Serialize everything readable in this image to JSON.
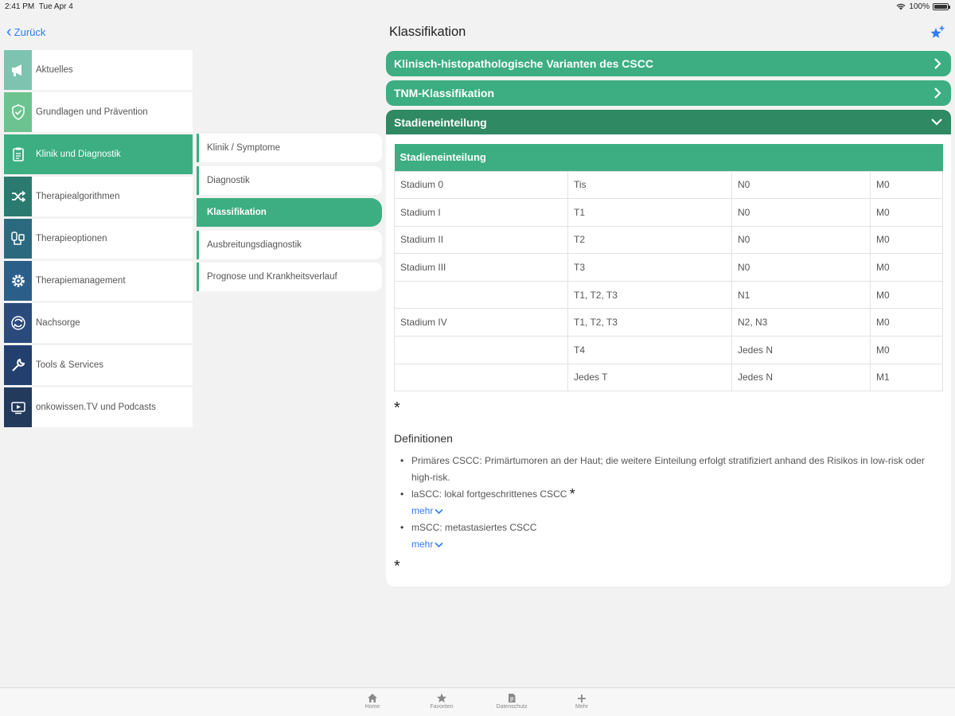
{
  "status": {
    "time": "2:41 PM",
    "date": "Tue Apr 4",
    "battery": "100%"
  },
  "nav": {
    "back_label": "Zurück",
    "title": "Klassifikation"
  },
  "colors": {
    "accent": "#3cae82",
    "accent_dark": "#2f8963",
    "link": "#2f7cf6"
  },
  "sidebar": {
    "items": [
      {
        "label": "Aktuelles",
        "icon": "megaphone-icon",
        "color": "#7dc3b0"
      },
      {
        "label": "Grundlagen und Prävention",
        "icon": "shield-icon",
        "color": "#6cc38f"
      },
      {
        "label": "Klinik und Diagnostik",
        "icon": "clipboard-icon",
        "color": "#3cae82"
      },
      {
        "label": "Therapiealgorithmen",
        "icon": "shuffle-icon",
        "color": "#2b7a6f"
      },
      {
        "label": "Therapieoptionen",
        "icon": "infusion-icon",
        "color": "#2b6a7e"
      },
      {
        "label": "Therapiemanagement",
        "icon": "gear-icon",
        "color": "#2b5f8a"
      },
      {
        "label": "Nachsorge",
        "icon": "refresh-icon",
        "color": "#2b4a7c"
      },
      {
        "label": "Tools & Services",
        "icon": "wrench-icon",
        "color": "#233f6e"
      },
      {
        "label": "onkowissen.TV und Podcasts",
        "icon": "video-icon",
        "color": "#223a5c"
      }
    ]
  },
  "submenu": {
    "items": [
      {
        "label": "Klinik / Symptome"
      },
      {
        "label": "Diagnostik"
      },
      {
        "label": "Klassifikation"
      },
      {
        "label": "Ausbreitungsdiagnostik"
      },
      {
        "label": "Prognose und Krankheitsverlauf"
      }
    ]
  },
  "accordions": [
    {
      "label": "Klinisch-histopathologische Varianten des CSCC"
    },
    {
      "label": "TNM-Klassifikation"
    },
    {
      "label": "Stadieneinteilung"
    }
  ],
  "table": {
    "header": "Stadieneinteilung",
    "rows": [
      [
        "Stadium 0",
        "Tis",
        "N0",
        "M0"
      ],
      [
        "Stadium I",
        "T1",
        "N0",
        "M0"
      ],
      [
        "Stadium II",
        "T2",
        "N0",
        "M0"
      ],
      [
        "Stadium III",
        "T3",
        "N0",
        "M0"
      ],
      [
        "",
        "T1, T2, T3",
        "N1",
        "M0"
      ],
      [
        "Stadium IV",
        "T1, T2, T3",
        "N2, N3",
        "M0"
      ],
      [
        "",
        "T4",
        "Jedes N",
        "M0"
      ],
      [
        "",
        "Jedes T",
        "Jedes N",
        "M1"
      ]
    ]
  },
  "definitions": {
    "title": "Definitionen",
    "asterisk": "*",
    "items": [
      {
        "text": "Primäres CSCC: Primärtumoren an der Haut; die weitere Einteilung erfolgt stratifiziert anhand des Risikos in low-risk oder high-risk."
      },
      {
        "text": "laSCC: lokal fortgeschrittenes CSCC",
        "more": "mehr"
      },
      {
        "text": "mSCC: metastasiertes CSCC",
        "more": "mehr"
      }
    ]
  },
  "tabbar": {
    "items": [
      {
        "label": "Home",
        "icon": "home-icon"
      },
      {
        "label": "Favoriten",
        "icon": "star-icon"
      },
      {
        "label": "Datenschutz",
        "icon": "document-icon"
      },
      {
        "label": "Mehr",
        "icon": "plus-icon"
      }
    ]
  }
}
